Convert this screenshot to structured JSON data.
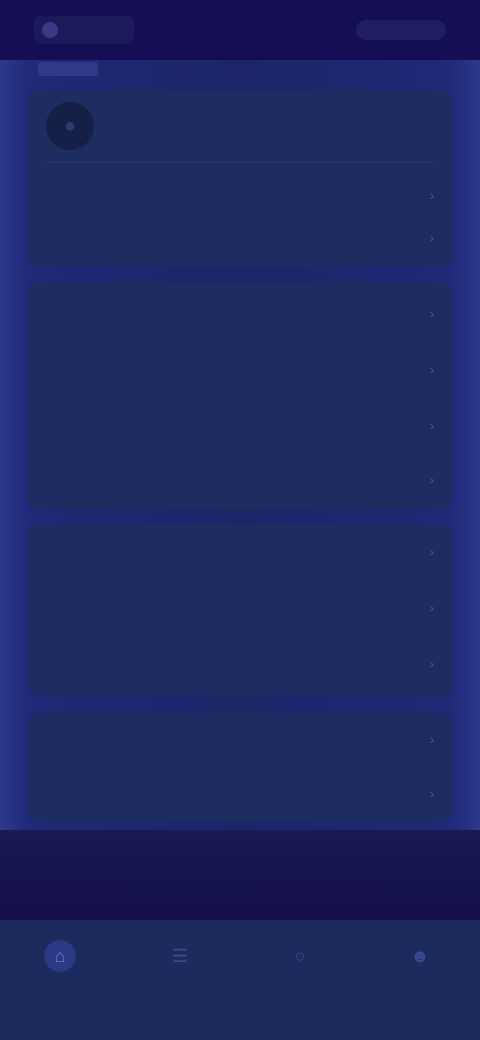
{
  "header": {
    "logo_icon": "app-logo-icon",
    "action_icon": "top-right-action"
  },
  "section": {
    "title": ""
  },
  "profile_card": {
    "avatar_icon": "user-avatar-icon",
    "name": "",
    "rows": [
      {
        "label": ""
      },
      {
        "label": ""
      }
    ]
  },
  "settings_card": {
    "rows": [
      {
        "label": ""
      },
      {
        "label": ""
      },
      {
        "label": ""
      },
      {
        "label": ""
      }
    ]
  },
  "info_card": {
    "rows": [
      {
        "label": ""
      },
      {
        "label": ""
      },
      {
        "label": ""
      }
    ]
  },
  "extra_card": {
    "rows": [
      {
        "label": ""
      },
      {
        "label": ""
      }
    ]
  },
  "footer": {
    "link_label": ""
  },
  "tabbar": {
    "tabs": [
      {
        "label": "",
        "icon": "home-icon",
        "active": true
      },
      {
        "label": "",
        "icon": "list-icon",
        "active": false
      },
      {
        "label": "",
        "icon": "chat-icon",
        "active": false
      },
      {
        "label": "",
        "icon": "profile-icon",
        "active": false
      }
    ]
  },
  "colors": {
    "background": "#14104a",
    "card": "#1d2d62",
    "tabbar": "#1c2b5e",
    "accent": "#2a3a84"
  }
}
